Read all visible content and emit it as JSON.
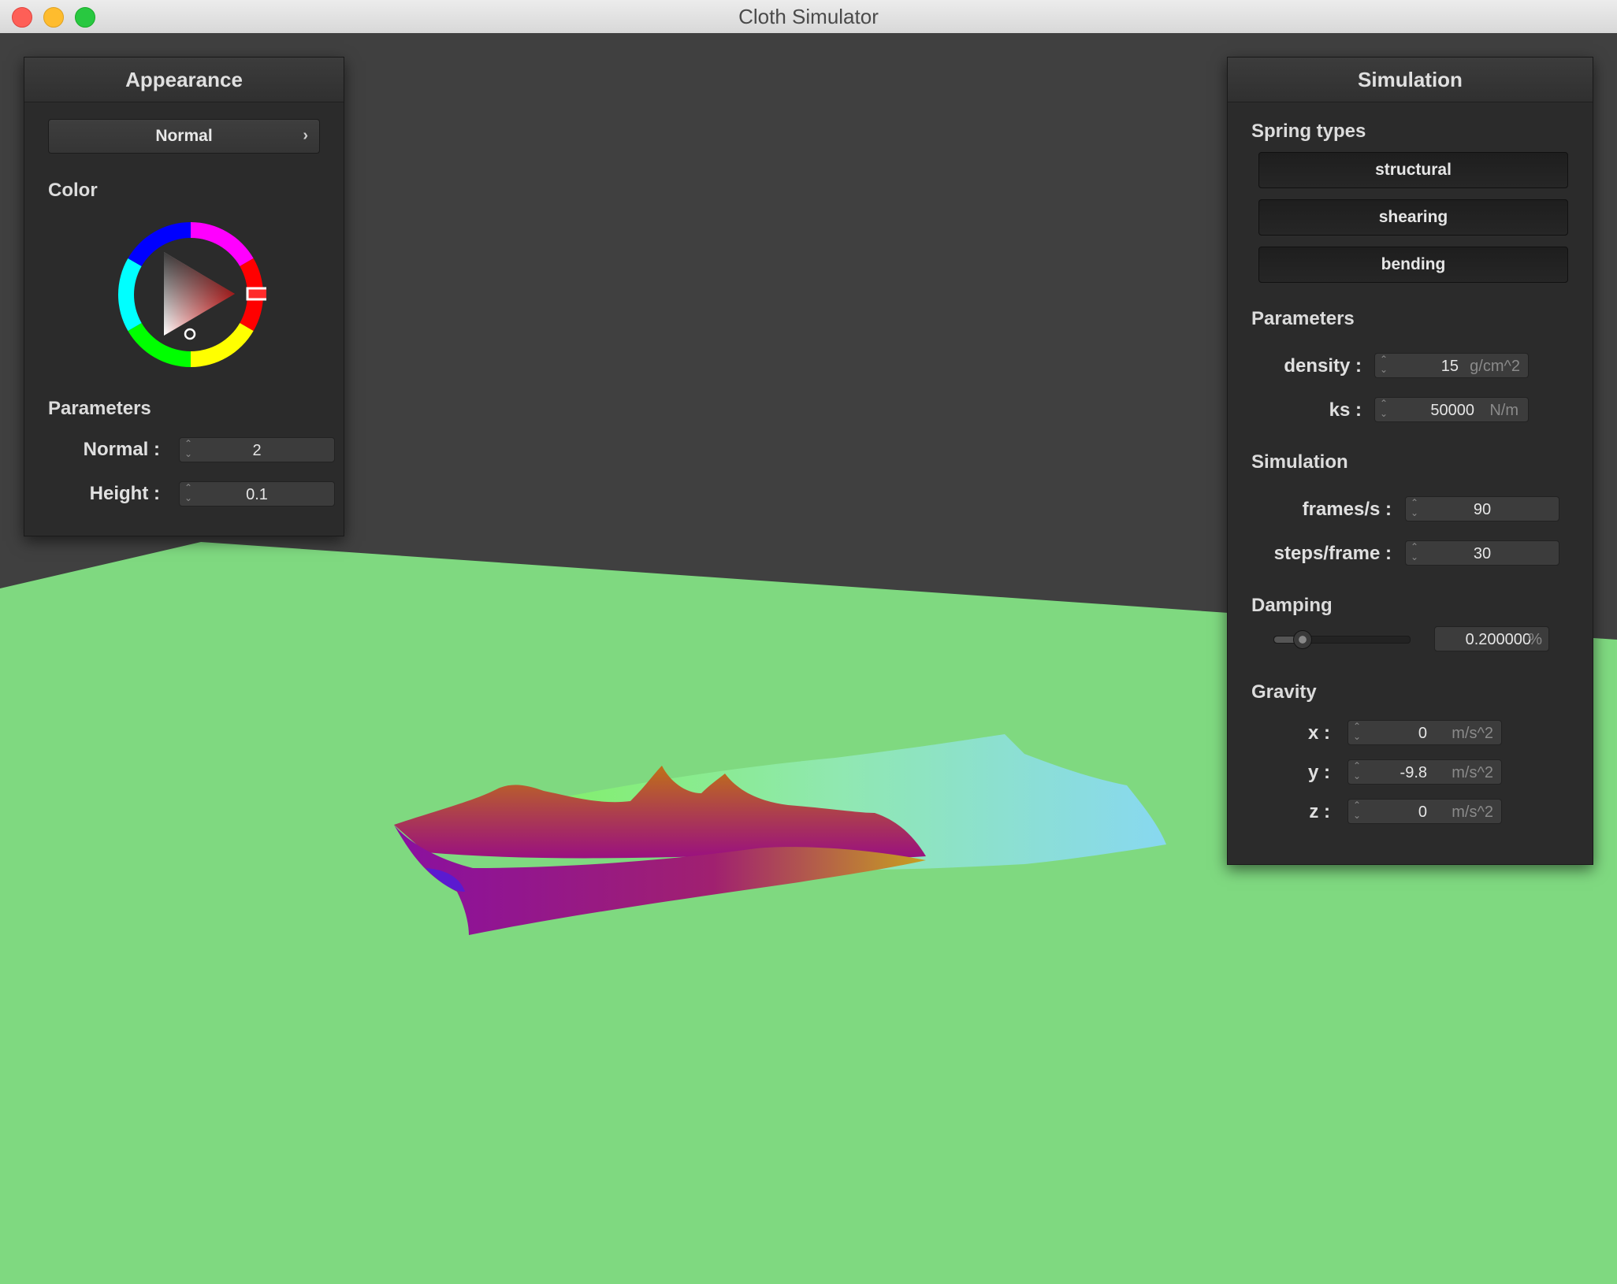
{
  "window": {
    "title": "Cloth Simulator"
  },
  "colors": {
    "ground": "#7fd980",
    "background": "#404040",
    "panel": "#2b2b2b"
  },
  "appearance": {
    "header": "Appearance",
    "shader": "Normal",
    "color_label": "Color",
    "selected_color": "#ff0000",
    "params_label": "Parameters",
    "normal_label": "Normal :",
    "normal_value": "2",
    "height_label": "Height :",
    "height_value": "0.1"
  },
  "simulation": {
    "header": "Simulation",
    "spring_label": "Spring types",
    "springs": [
      "structural",
      "shearing",
      "bending"
    ],
    "params_label": "Parameters",
    "density_label": "density :",
    "density_value": "15",
    "density_unit": "g/cm^2",
    "ks_label": "ks :",
    "ks_value": "50000",
    "ks_unit": "N/m",
    "sim_label": "Simulation",
    "fps_label": "frames/s :",
    "fps_value": "90",
    "steps_label": "steps/frame :",
    "steps_value": "30",
    "damping_label": "Damping",
    "damping_value": "0.200000",
    "damping_unit": "%",
    "damping_level": 0.2,
    "gravity_label": "Gravity",
    "gx_label": "x :",
    "gx_value": "0",
    "gy_label": "y :",
    "gy_value": "-9.8",
    "gz_label": "z :",
    "gz_value": "0",
    "gravity_unit": "m/s^2"
  }
}
